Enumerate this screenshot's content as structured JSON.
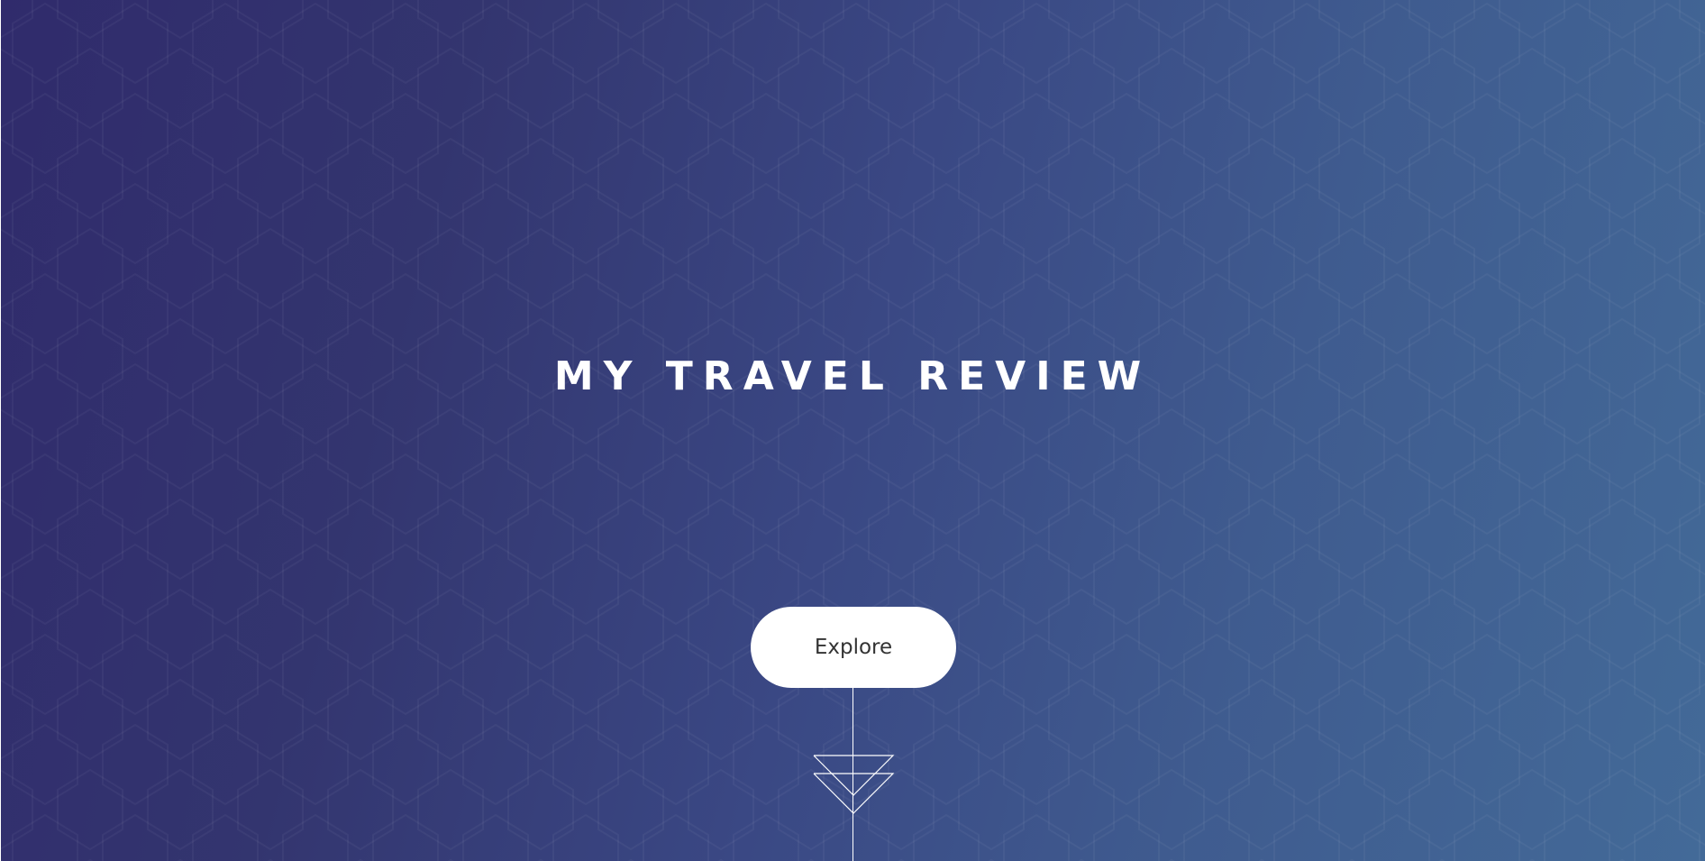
{
  "hero": {
    "title": "MY TRAVEL REVIEW",
    "explore_label": "Explore",
    "scroll_icon": "double-chevron-down-icon"
  },
  "colors": {
    "gradient_start": "#302b6c",
    "gradient_end": "#436a98",
    "button_bg": "#ffffff",
    "button_text": "#333333",
    "title_text": "#ffffff"
  }
}
